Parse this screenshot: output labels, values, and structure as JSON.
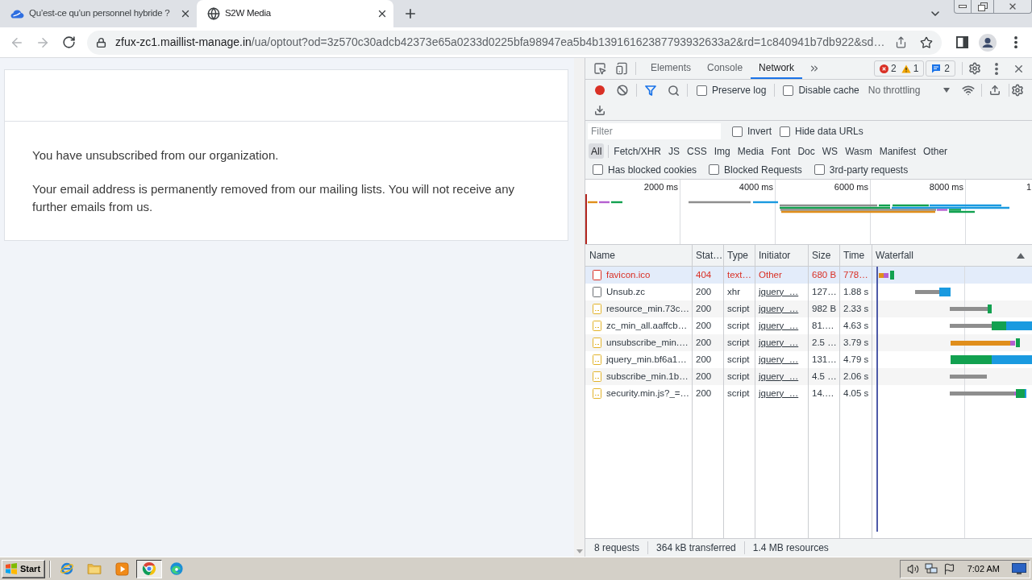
{
  "browser": {
    "tabs": [
      {
        "title": "Qu’est-ce qu’un personnel hybride ?",
        "selected": false,
        "kind": "site"
      },
      {
        "title": "S2W Media",
        "selected": true,
        "kind": "globe"
      }
    ],
    "address": {
      "host": "zfux-zc1.maillist-manage.in",
      "path": "/ua/optout?od=3z570c30adcb42373e65a0233d0225bfa98947ea5b4b13916162387793932633a2&rd=1c840941b7db922&sd…"
    }
  },
  "page": {
    "paragraphs": [
      "You have unsubscribed from our organization.",
      "Your email address is permanently removed from our mailing lists. You will not receive any further emails from us."
    ]
  },
  "devtools": {
    "tabs": [
      {
        "label": "Elements",
        "selected": false
      },
      {
        "label": "Console",
        "selected": false
      },
      {
        "label": "Network",
        "selected": true
      }
    ],
    "badges": {
      "errors": "2",
      "warnings": "1",
      "messages": "2"
    },
    "toolbar": {
      "recording": true,
      "filter_active": true,
      "preserve_log": {
        "label": "Preserve log",
        "checked": false
      },
      "disable_cache": {
        "label": "Disable cache",
        "checked": false
      },
      "throttling": "No throttling"
    },
    "filter": {
      "placeholder": "Filter",
      "options": [
        {
          "label": "Invert",
          "checked": false
        },
        {
          "label": "Hide data URLs",
          "checked": false
        }
      ]
    },
    "types": [
      {
        "label": "All",
        "selected": true
      },
      {
        "label": "Fetch/XHR",
        "selected": false
      },
      {
        "label": "JS",
        "selected": false
      },
      {
        "label": "CSS",
        "selected": false
      },
      {
        "label": "Img",
        "selected": false
      },
      {
        "label": "Media",
        "selected": false
      },
      {
        "label": "Font",
        "selected": false
      },
      {
        "label": "Doc",
        "selected": false
      },
      {
        "label": "WS",
        "selected": false
      },
      {
        "label": "Wasm",
        "selected": false
      },
      {
        "label": "Manifest",
        "selected": false
      },
      {
        "label": "Other",
        "selected": false
      }
    ],
    "request_filters": [
      {
        "label": "Has blocked cookies",
        "checked": false
      },
      {
        "label": "Blocked Requests",
        "checked": false
      },
      {
        "label": "3rd-party requests",
        "checked": false
      }
    ],
    "overview": {
      "ticks": [
        "2000 ms",
        "4000 ms",
        "6000 ms",
        "8000 ms",
        "1"
      ]
    },
    "table": {
      "columns": [
        {
          "label": "Name",
          "sorted": false
        },
        {
          "label": "Stat…",
          "sorted": false
        },
        {
          "label": "Type",
          "sorted": false
        },
        {
          "label": "Initiator",
          "sorted": false
        },
        {
          "label": "Size",
          "sorted": false
        },
        {
          "label": "Time",
          "sorted": false
        },
        {
          "label": "Waterfall",
          "sorted": true
        }
      ],
      "rows": [
        {
          "name": "favicon.ico",
          "status": "404",
          "type": "text…",
          "initiator": "Other",
          "size": "680 B",
          "time": "778…",
          "kind": "document",
          "error": true,
          "linked": false,
          "hovered": true
        },
        {
          "name": "Unsub.zc",
          "status": "200",
          "type": "xhr",
          "initiator": "jquery_…",
          "size": "127…",
          "time": "1.88 s",
          "kind": "document",
          "error": false,
          "linked": true,
          "hovered": false
        },
        {
          "name": "resource_min.73c…",
          "status": "200",
          "type": "script",
          "initiator": "jquery_…",
          "size": "982 B",
          "time": "2.33 s",
          "kind": "script",
          "error": false,
          "linked": true,
          "hovered": false
        },
        {
          "name": "zc_min_all.aaffcb…",
          "status": "200",
          "type": "script",
          "initiator": "jquery_…",
          "size": "81.…",
          "time": "4.63 s",
          "kind": "script",
          "error": false,
          "linked": true,
          "hovered": false
        },
        {
          "name": "unsubscribe_min.…",
          "status": "200",
          "type": "script",
          "initiator": "jquery_…",
          "size": "2.5 …",
          "time": "3.79 s",
          "kind": "script",
          "error": false,
          "linked": true,
          "hovered": false
        },
        {
          "name": "jquery_min.bf6a1…",
          "status": "200",
          "type": "script",
          "initiator": "jquery_…",
          "size": "131…",
          "time": "4.79 s",
          "kind": "script",
          "error": false,
          "linked": true,
          "hovered": false
        },
        {
          "name": "subscribe_min.1b…",
          "status": "200",
          "type": "script",
          "initiator": "jquery_…",
          "size": "4.5 …",
          "time": "2.06 s",
          "kind": "script",
          "error": false,
          "linked": true,
          "hovered": false
        },
        {
          "name": "security.min.js?_=…",
          "status": "200",
          "type": "script",
          "initiator": "jquery_…",
          "size": "14.…",
          "time": "4.05 s",
          "kind": "script",
          "error": false,
          "linked": true,
          "hovered": false
        }
      ]
    },
    "status": [
      "8 requests",
      "364 kB transferred",
      "1.4 MB resources"
    ]
  },
  "taskbar": {
    "start": "Start",
    "apps": [
      {
        "kind": "ie",
        "active": false
      },
      {
        "kind": "folder",
        "active": false
      },
      {
        "kind": "media",
        "active": false
      },
      {
        "kind": "chrome",
        "active": true
      },
      {
        "kind": "edge",
        "active": false
      }
    ],
    "clock": "7:02 AM"
  }
}
